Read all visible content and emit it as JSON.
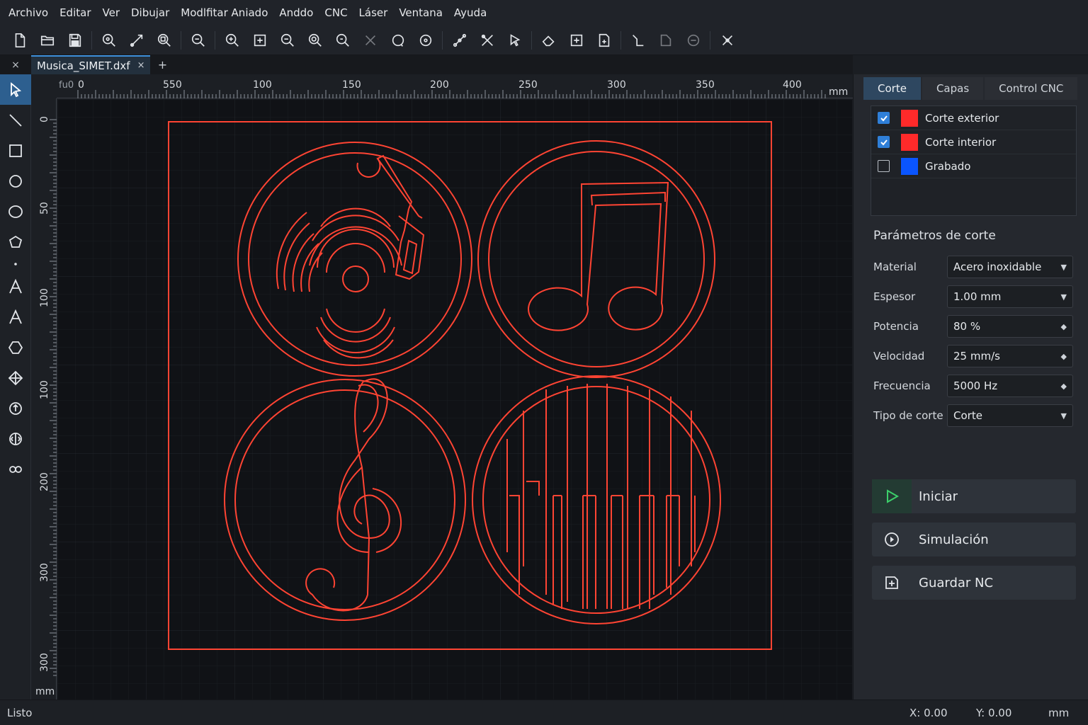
{
  "menu": [
    "Archivo",
    "Editar",
    "Ver",
    "Dibujar",
    "Modlfitar Aniado",
    "Anddo",
    "CNC",
    "Láser",
    "Ventana",
    "Ayuda"
  ],
  "tabs": {
    "document": "Musica_SIMET.dxf",
    "close_symbol": "×",
    "add_symbol": "+",
    "close_all_symbol": "×"
  },
  "ruler": {
    "top_labels": [
      "fu0",
      "550",
      "100",
      "150",
      "200",
      "250",
      "300",
      "350",
      "400"
    ],
    "top_unit": "mm",
    "left_labels": [
      "0",
      "50",
      "100",
      "100",
      "200",
      "300",
      "300"
    ],
    "left_unit": "mm"
  },
  "panel": {
    "tabs": [
      "Corte",
      "Capas",
      "Control CNC"
    ],
    "active_tab": "Corte",
    "layers": [
      {
        "name": "Corte exterior",
        "checked": true,
        "color": "#ff2a2a"
      },
      {
        "name": "Corte interior",
        "checked": true,
        "color": "#ff2a2a"
      },
      {
        "name": "Grabado",
        "checked": false,
        "color": "#0a55ff"
      }
    ],
    "params_title": "Parámetros de corte",
    "params": [
      {
        "label": "Material",
        "value": "Acero inoxidable",
        "control": "dropdown"
      },
      {
        "label": "Espesor",
        "value": "1.00 mm",
        "control": "dropdown"
      },
      {
        "label": "Potencia",
        "value": "80 %",
        "control": "spin"
      },
      {
        "label": "Velocidad",
        "value": "25 mm/s",
        "control": "spin"
      },
      {
        "label": "Frecuencia",
        "value": "5000 Hz",
        "control": "spin"
      },
      {
        "label": "Tipo de corte",
        "value": "Corte",
        "control": "dropdown"
      }
    ],
    "actions": {
      "start": "Iniciar",
      "simulate": "Simulación",
      "save_nc": "Guardar NC"
    }
  },
  "status": {
    "message": "Listo",
    "x": "X: 0.00",
    "y": "Y: 0.00",
    "unit": "mm"
  },
  "colors": {
    "cut_line": "#ff4433",
    "accent": "#2f7fd8",
    "start_icon": "#3ccf6a"
  },
  "toolbar_icons": [
    "new-file-icon",
    "open-folder-icon",
    "save-icon",
    "zoom-fit-icon",
    "measure-icon",
    "zoom-window-icon",
    "zoom-icon",
    "zoom-in-icon",
    "zoom-extents-icon",
    "zoom-out-icon",
    "zoom-previous-icon",
    "zoom-all-icon",
    "snap-icon",
    "circle-select-icon",
    "circle-snap-icon",
    "node-edit-icon",
    "trim-icon",
    "pointer-snap-icon",
    "erase-icon",
    "insert-icon",
    "export-icon",
    "path-icon",
    "lead-in-icon",
    "order-icon",
    "transform-icon"
  ],
  "left_tool_icons": [
    "select-arrow-icon",
    "line-tool-icon",
    "rectangle-tool-icon",
    "circle-tool-icon",
    "ellipse-tool-icon",
    "polygon-tool-icon",
    "point-tool-icon",
    "text-tool-icon",
    "text-outline-tool-icon",
    "hexagon-tool-icon",
    "origin-tool-icon",
    "rotate-tool-icon",
    "mirror-tool-icon",
    "chain-tool-icon"
  ]
}
